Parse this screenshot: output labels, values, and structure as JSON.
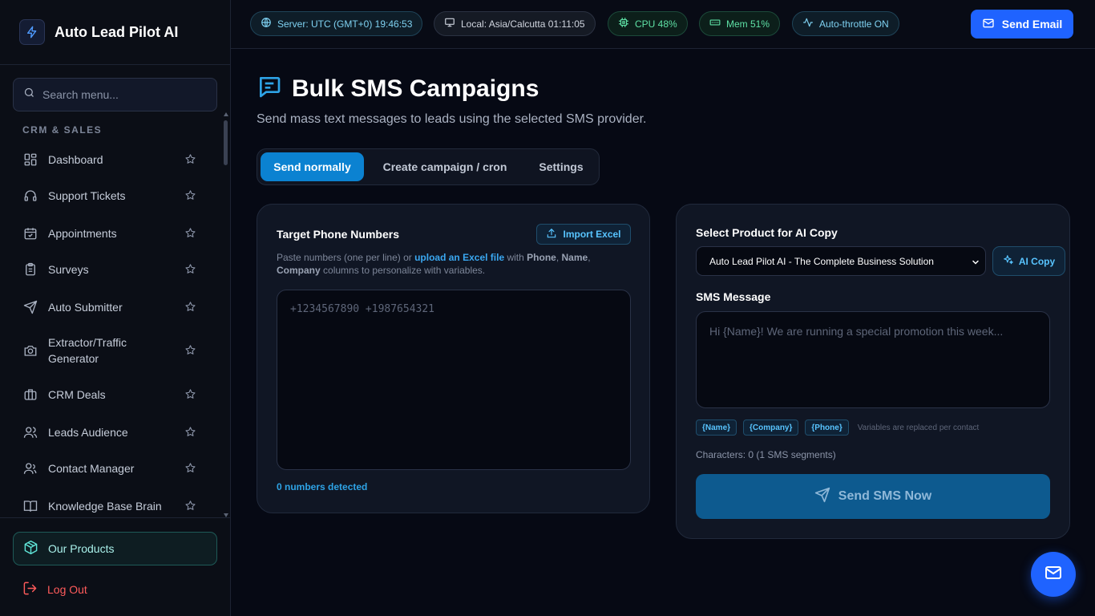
{
  "app": {
    "name": "Auto Lead Pilot AI"
  },
  "sidebar": {
    "search_placeholder": "Search menu...",
    "section_title": "CRM & SALES",
    "items": [
      {
        "label": "Dashboard",
        "icon": "dashboard-icon"
      },
      {
        "label": "Support Tickets",
        "icon": "headset-icon"
      },
      {
        "label": "Appointments",
        "icon": "calendar-icon"
      },
      {
        "label": "Surveys",
        "icon": "clipboard-icon"
      },
      {
        "label": "Auto Submitter",
        "icon": "send-icon"
      },
      {
        "label": "Extractor/Traffic Generator",
        "icon": "camera-icon"
      },
      {
        "label": "CRM Deals",
        "icon": "briefcase-icon"
      },
      {
        "label": "Leads Audience",
        "icon": "users-icon"
      },
      {
        "label": "Contact Manager",
        "icon": "contact-icon"
      },
      {
        "label": "Knowledge Base Brain",
        "icon": "book-icon"
      }
    ],
    "products_label": "Our Products",
    "logout_label": "Log Out"
  },
  "topbar": {
    "server": "Server: UTC (GMT+0) 19:46:53",
    "local": "Local: Asia/Calcutta 01:11:05",
    "cpu": "CPU 48%",
    "mem": "Mem 51%",
    "throttle": "Auto-throttle ON",
    "send_email": "Send Email"
  },
  "page": {
    "title": "Bulk SMS Campaigns",
    "subtitle": "Send mass text messages to leads using the selected SMS provider.",
    "tabs": [
      "Send normally",
      "Create campaign / cron",
      "Settings"
    ],
    "active_tab": "Send normally"
  },
  "targets": {
    "title": "Target Phone Numbers",
    "import_label": "Import Excel",
    "helper_pre": "Paste numbers (one per line) or",
    "helper_link": "upload an Excel file",
    "helper_mid": "with",
    "col_phone": "Phone",
    "col_name": "Name",
    "col_company": "Company",
    "helper_post": "columns to personalize with variables.",
    "placeholder": "+1234567890 +1987654321",
    "detected": "0 numbers detected"
  },
  "compose": {
    "product_title": "Select Product for AI Copy",
    "product_selected": "Auto Lead Pilot AI - The Complete Business Solution",
    "ai_copy_label": "AI Copy",
    "message_title": "SMS Message",
    "message_placeholder": "Hi {Name}! We are running a special promotion this week...",
    "variables": [
      "{Name}",
      "{Company}",
      "{Phone}"
    ],
    "variables_note": "Variables are replaced per contact",
    "char_count": "Characters: 0 (1 SMS segments)",
    "send_label": "Send SMS Now"
  },
  "colors": {
    "accent": "#1f63ff",
    "tab_active": "#0b82d1",
    "cyan": "#58c4ff",
    "danger": "#ff5b5b"
  }
}
